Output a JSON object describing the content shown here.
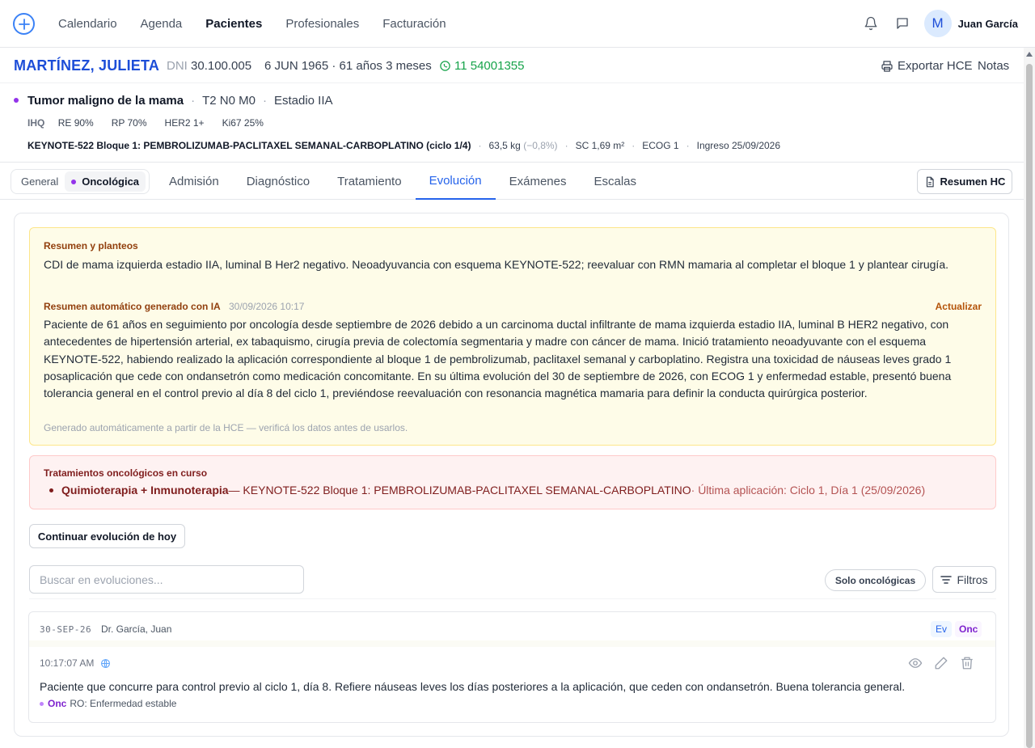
{
  "nav": {
    "items": [
      "Calendario",
      "Agenda",
      "Pacientes",
      "Profesionales",
      "Facturación"
    ],
    "active": "Pacientes",
    "user": {
      "initial": "M",
      "name": "Juan García"
    }
  },
  "patient": {
    "name": "MARTÍNEZ, JULIETA",
    "dni_label": "DNI",
    "dni": "30.100.005",
    "dob": "6 JUN 1965 · 61 años 3 meses",
    "phone": "11 54001355",
    "export_label": "Exportar HCE",
    "notes_label": "Notas"
  },
  "diagnosis": {
    "main": "Tumor maligno de la mama",
    "tnm": "T2 N0 M0",
    "stage": "Estadio IIA",
    "ihq_label": "IHQ",
    "markers": [
      "RE 90%",
      "RP 70%",
      "HER2 1+",
      "Ki67 25%"
    ],
    "scheme": "KEYNOTE-522 Bloque 1: PEMBROLIZUMAB-PACLITAXEL SEMANAL-CARBOPLATINO (ciclo 1/4)",
    "weight": "63,5 kg",
    "weight_change": "(−0,8%)",
    "sc": "SC 1,69 m²",
    "ecog": "ECOG 1",
    "admission": "Ingreso 25/09/2026"
  },
  "tabs": {
    "segment": [
      "General",
      "Oncológica"
    ],
    "segment_active": "Oncológica",
    "items": [
      "Admisión",
      "Diagnóstico",
      "Tratamiento",
      "Evolución",
      "Exámenes",
      "Escalas"
    ],
    "active": "Evolución",
    "summary_button": "Resumen HC"
  },
  "summary": {
    "title": "Resumen y planteos",
    "text": "CDI de mama izquierda estadio IIA, luminal B Her2 negativo. Neoadyuvancia con esquema KEYNOTE-522; reevaluar con RMN mamaria al completar el bloque 1 y plantear cirugía.",
    "ai_title": "Resumen automático generado con IA",
    "ai_date": "30/09/2026 10:17",
    "ai_update": "Actualizar",
    "ai_text": "Paciente de 61 años en seguimiento por oncología desde septiembre de 2026 debido a un carcinoma ductal infiltrante de mama izquierda estadio IIA, luminal B HER2 negativo, con antecedentes de hipertensión arterial, ex tabaquismo, cirugía previa de colectomía segmentaria y madre con cáncer de mama. Inició tratamiento neoadyuvante con el esquema KEYNOTE-522, habiendo realizado la aplicación correspondiente al bloque 1 de pembrolizumab, paclitaxel semanal y carboplatino. Registra una toxicidad de náuseas leves grado 1 posaplicación que cede con ondansetrón como medicación concomitante. En su última evolución del 30 de septiembre de 2026, con ECOG 1 y enfermedad estable, presentó buena tolerancia general en el control previo al día 8 del ciclo 1, previéndose reevaluación con resonancia magnética mamaria para definir la conducta quirúrgica posterior.",
    "ai_note": "Generado automáticamente a partir de la HCE — verificá los datos antes de usarlos."
  },
  "treatments": {
    "title": "Tratamientos oncológicos en curso",
    "items": [
      {
        "type": "Quimioterapia + Inmunoterapia",
        "scheme": " — KEYNOTE-522 Bloque 1: PEMBROLIZUMAB-PACLITAXEL SEMANAL-CARBOPLATINO",
        "last": " · Última aplicación: Ciclo 1, Día 1 (25/09/2026)"
      }
    ]
  },
  "actions": {
    "continue": "Continuar evolución de hoy",
    "search_placeholder": "Buscar en evoluciones...",
    "only_onc": "Solo oncológicas",
    "filters": "Filtros"
  },
  "evolutions": [
    {
      "date": "30-SEP-26",
      "doctor": "Dr. García, Juan",
      "badge_ev": "Ev",
      "badge_onc": "Onc",
      "time": "10:17:07 AM",
      "text": "Paciente que concurre para control previo al ciclo 1, día 8. Refiere náuseas leves los días posteriores a la aplicación, que ceden con ondansetrón. Buena tolerancia general.",
      "tag": "Onc",
      "ro": "RO: Enfermedad estable"
    }
  ],
  "colors": {
    "accent": "#2563eb",
    "patient_name": "#1d4ed8",
    "phone": "#16a34a",
    "onc_purple": "#9333ea",
    "summary_bg": "#fefce8",
    "treatment_bg": "#fef2f2"
  }
}
